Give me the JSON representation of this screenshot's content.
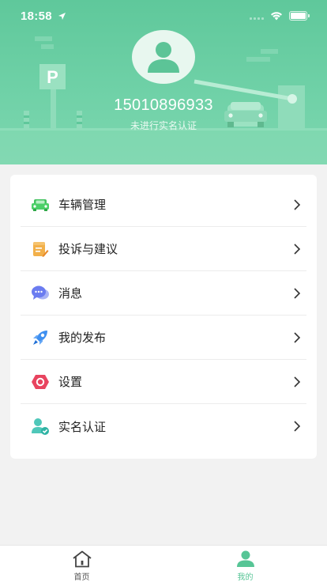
{
  "status_bar": {
    "time": "18:58"
  },
  "profile": {
    "phone": "15010896933",
    "verify_status": "未进行实名认证",
    "parking_sign": "P"
  },
  "menu": {
    "items": [
      {
        "label": "车辆管理",
        "icon": "car-icon"
      },
      {
        "label": "投诉与建议",
        "icon": "note-edit-icon"
      },
      {
        "label": "消息",
        "icon": "chat-bubble-icon"
      },
      {
        "label": "我的发布",
        "icon": "rocket-icon"
      },
      {
        "label": "设置",
        "icon": "settings-hexagon-icon"
      },
      {
        "label": "实名认证",
        "icon": "user-verified-icon"
      }
    ]
  },
  "tabbar": {
    "tabs": [
      {
        "label": "首页",
        "icon": "home-icon",
        "active": false
      },
      {
        "label": "我的",
        "icon": "user-icon",
        "active": true
      }
    ]
  },
  "colors": {
    "header_green": "#6fd1a7",
    "active_tab": "#57c596",
    "background": "#f2f2f2"
  }
}
